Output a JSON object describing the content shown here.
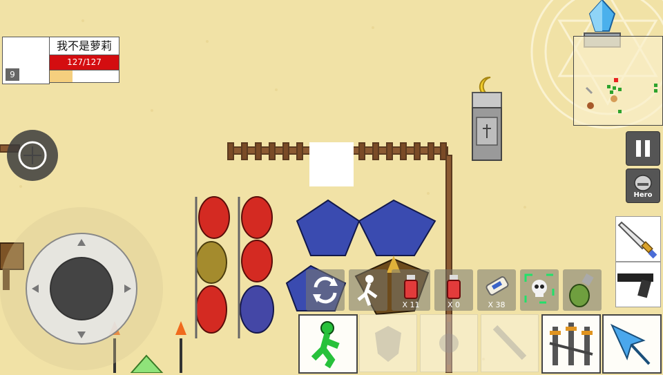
{
  "player": {
    "name": "我不是萝莉",
    "level": "9",
    "hp_text": "127/127",
    "xp_fraction": 0.33
  },
  "hud": {
    "hero_label": "Hero"
  },
  "items": [
    {
      "icon": "swap-arrows-icon",
      "count": ""
    },
    {
      "icon": "dash-runner-icon",
      "count": ""
    },
    {
      "icon": "red-potion-icon",
      "count": "X 11"
    },
    {
      "icon": "red-potion-icon",
      "count": "X 0"
    },
    {
      "icon": "scroll-icon",
      "count": "X 38"
    },
    {
      "icon": "skull-target-icon",
      "count": ""
    },
    {
      "icon": "grenade-icon",
      "count": ""
    }
  ],
  "skills": [
    {
      "icon": "green-runner-icon",
      "active": true
    },
    {
      "icon": "shield-icon",
      "active": false
    },
    {
      "icon": "sparkle-icon",
      "active": false
    },
    {
      "icon": "sword-icon",
      "active": false
    },
    {
      "icon": "triple-swords-icon",
      "active": true
    },
    {
      "icon": "ice-arrow-icon",
      "active": true
    }
  ]
}
